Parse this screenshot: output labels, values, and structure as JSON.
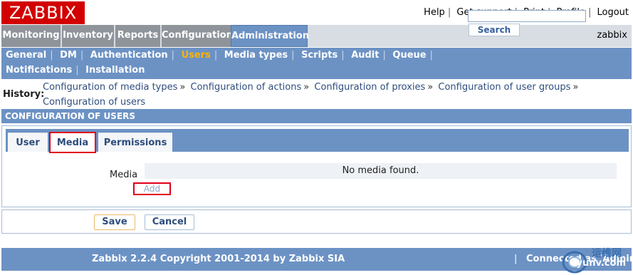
{
  "header": {
    "logo": "ZABBIX",
    "links": [
      "Help",
      "Get support",
      "Print",
      "Profile",
      "Logout"
    ],
    "user": "zabbix"
  },
  "main_menu": {
    "items": [
      "Monitoring",
      "Inventory",
      "Reports",
      "Configuration",
      "Administration"
    ],
    "active": "Administration"
  },
  "sub_menu": {
    "row1": [
      "General",
      "DM",
      "Authentication",
      "Users",
      "Media types",
      "Scripts",
      "Audit",
      "Queue"
    ],
    "row2": [
      "Notifications",
      "Installation"
    ],
    "active": "Users",
    "search_value": "",
    "search_button": "Search"
  },
  "history": {
    "label": "History:",
    "items": [
      "Configuration of media types",
      "Configuration of actions",
      "Configuration of proxies",
      "Configuration of user groups",
      "Configuration of users"
    ],
    "separator": "»"
  },
  "section": {
    "title": "CONFIGURATION OF USERS"
  },
  "tabs": {
    "items": [
      "User",
      "Media",
      "Permissions"
    ],
    "active": "Media"
  },
  "media": {
    "label": "Media",
    "empty_text": "No media found.",
    "add_link": "Add"
  },
  "buttons": {
    "save": "Save",
    "cancel": "Cancel"
  },
  "footer": {
    "copyright": "Zabbix 2.2.4 Copyright 2001-2014 by Zabbix SIA",
    "separator": "|",
    "connected": "Connected as 'Admin'"
  },
  "watermark": {
    "cn": "运维网",
    "en": "iyunv.com"
  },
  "colors": {
    "accent": "#6c92c4",
    "logo_red": "#d20000",
    "active_submenu": "#ffb300",
    "highlight_box": "#e0001a"
  }
}
